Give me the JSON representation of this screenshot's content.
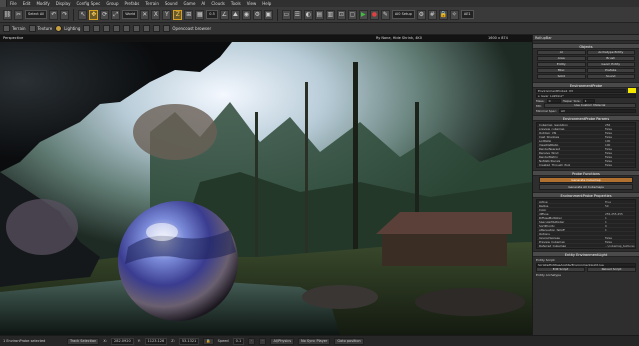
{
  "menu": [
    "File",
    "Edit",
    "Modify",
    "Display",
    "Config Spec",
    "Group",
    "Prefabs",
    "Terrain",
    "Sound",
    "Game",
    "AI",
    "Clouds",
    "Tools",
    "View",
    "Help"
  ],
  "toolbar": {
    "select_all_label": "Select All",
    "coord_system": "World",
    "snap_value": "0.5",
    "angle_label": "AE1",
    "id_label": "AI0",
    "grid_value": "1",
    "setup_label": "AI0 Setup"
  },
  "toolbar2": {
    "items": [
      "Terrain",
      "Texture",
      "Lighting"
    ],
    "object_browser": "Opencoast browser"
  },
  "viewport": {
    "header_left": "Perspective",
    "header_center": "Ry None, Hide Shrink, 4K0",
    "header_info": "1600 x 874",
    "header_info2": "DEFAULT"
  },
  "rollup": {
    "title": "RollupBar",
    "objects_section": "Objects",
    "object_buttons": [
      "AI",
      "Archetype Entity",
      "Area",
      "Brush",
      "Entity",
      "Geom Entity",
      "Misc",
      "Prefabs",
      "Solid",
      "Sound"
    ],
    "env_probe_section": "EnvironmentProbe",
    "probe_name": "EnvironmentProbe1_03",
    "swatch_color": "#f5e800",
    "layer_field": "s_layer_Lighting*",
    "mass_label": "Mass:",
    "mass_value": "0",
    "helper_label": "Helper Size:",
    "helper_value": "1",
    "mtl_label": "Mtl:",
    "mtl_button": "Use Custom Material",
    "minspec_label": "Minimal Spec:",
    "minspec_value": "All",
    "params_section": "EnvironmentProbe Params",
    "params": [
      {
        "k": "Cubemap_resolution",
        "v": "256"
      },
      {
        "k": "preview_cubemap",
        "v": "False"
      },
      {
        "k": "Outdoor_VIS",
        "v": "False"
      },
      {
        "k": "Cast_Shadows",
        "v": "False"
      },
      {
        "k": "LodRatio",
        "v": "100"
      },
      {
        "k": "ViewDistRatio",
        "v": "100"
      },
      {
        "k": "RenderNearest",
        "v": "False"
      },
      {
        "k": "Receive_Wind",
        "v": "False"
      },
      {
        "k": "RenderMatrix",
        "v": "False"
      },
      {
        "k": "NoStaticDecals",
        "v": "False"
      },
      {
        "k": "Created_Through_Pool",
        "v": "False"
      }
    ],
    "probe_functions_section": "Probe Functions",
    "generate_cubemap": "Generate Cubemap",
    "generate_all": "Generate All Cubemaps",
    "probe_props_section": "EnvironmentProbe Properties",
    "props": [
      {
        "k": "Active",
        "v": "True"
      },
      {
        "k": "Radius",
        "v": "50"
      },
      {
        "k": "Color",
        "v": ""
      },
      {
        "k": "diffuse",
        "v": "255,255,255"
      },
      {
        "k": "DiffuseMultiplier",
        "v": "1"
      },
      {
        "k": "SpecularMultiplier",
        "v": "1"
      },
      {
        "k": "SortPriority",
        "v": "0"
      },
      {
        "k": "attenuation_falloff",
        "v": "1"
      },
      {
        "k": "Options",
        "v": ""
      },
      {
        "k": "IgnoreVisAreas",
        "v": "False"
      },
      {
        "k": "Preview_Cubemap",
        "v": "False"
      },
      {
        "k": "Deferred_Cubemap",
        "v": "...\\cubemap_textures"
      }
    ],
    "entity_section": "Entity EnvironmentLight",
    "entity_script_label": "Entity Script:",
    "entity_script_path": "Scripts/Entities/Lights/EnvironmentLight.lua",
    "edit_script": "Edit Script",
    "reload_script": "Reload Script",
    "entity_archetype": "Entity Archetype"
  },
  "status": {
    "selection": "1 EnvironProbe selected",
    "track_label": "Track Selection",
    "x_value": "282.0920",
    "y_value": "1123.126",
    "z_value": "53.1321",
    "speed_label": "Speed",
    "speed_value": "0.1",
    "physics": "AI/Physics",
    "no_sync": "No Sync Player",
    "goto": "Goto position"
  }
}
